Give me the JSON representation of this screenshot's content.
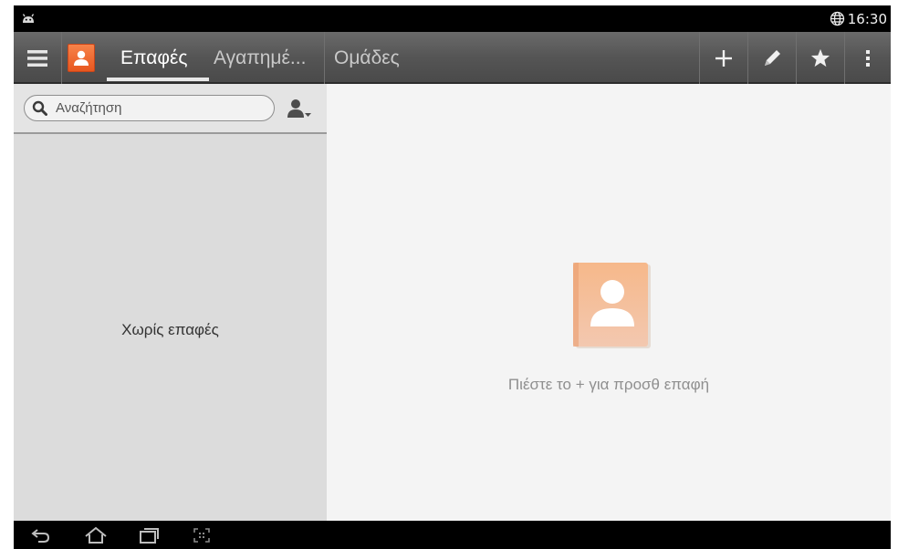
{
  "status_bar": {
    "time": "16:30",
    "icons": [
      "android-notification-icon",
      "globe-icon"
    ]
  },
  "action_bar": {
    "tabs": [
      {
        "label": "Επαφές",
        "active": true
      },
      {
        "label": "Αγαπημέ...",
        "active": false
      },
      {
        "label": "Ομάδες",
        "active": false
      }
    ],
    "actions": [
      "add-icon",
      "edit-icon",
      "star-icon",
      "overflow-menu-icon"
    ]
  },
  "search": {
    "placeholder": "Αναζήτηση"
  },
  "contact_list": {
    "empty_text": "Χωρίς επαφές"
  },
  "detail": {
    "empty_hint": "Πιέστε το + για προσθ επαφή"
  },
  "nav_bar": {
    "buttons": [
      "back-icon",
      "home-icon",
      "recent-apps-icon",
      "screenshot-icon"
    ]
  },
  "colors": {
    "action_bar": "#555555",
    "accent_orange": "#e8571f",
    "left_pane": "#dcdcdc",
    "right_pane": "#f4f4f4"
  }
}
